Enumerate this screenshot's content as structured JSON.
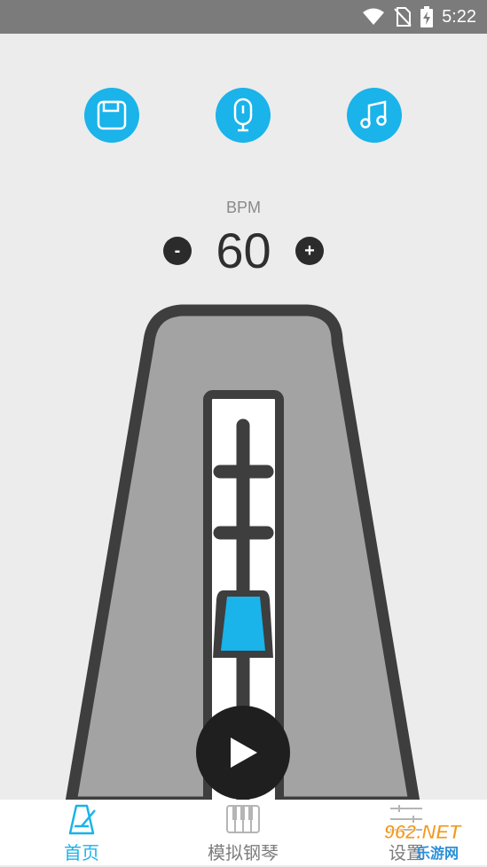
{
  "status_bar": {
    "time": "5:22"
  },
  "toolbar": {
    "save_icon": "floppy-disk-icon",
    "mic_icon": "microphone-icon",
    "music_icon": "music-note-icon"
  },
  "bpm": {
    "label": "BPM",
    "value": "60",
    "decrement_label": "-",
    "increment_label": "+"
  },
  "bottom_nav": {
    "items": [
      {
        "label": "首页",
        "icon": "metronome-icon",
        "active": true
      },
      {
        "label": "模拟钢琴",
        "icon": "piano-icon",
        "active": false
      },
      {
        "label": "设置",
        "icon": "sliders-icon",
        "active": false
      }
    ]
  },
  "watermark": {
    "brand": "962.NET",
    "text": "乐游网"
  },
  "colors": {
    "accent": "#1ab3ea",
    "status_bar": "#7b7b7b",
    "body_gray": "#a3a3a3",
    "outline": "#3e3e3e",
    "background": "#ececec"
  }
}
